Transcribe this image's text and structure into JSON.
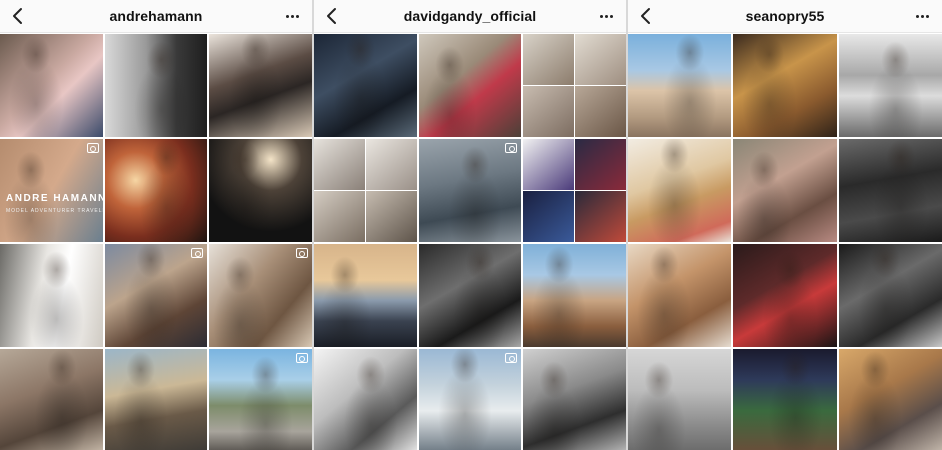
{
  "panels": [
    {
      "username": "andrehamann",
      "tiles": [
        {
          "desc": "man-in-pink-sweater-sofa",
          "video": false,
          "bg": "linear-gradient(135deg,#6b5a4e 0%,#c9a8a0 45%,#e8c6c4 60%,#3b4a6a 100%)"
        },
        {
          "desc": "man-profile-bw",
          "video": false,
          "bg": "linear-gradient(90deg,#d9d9d9 0%,#9a9a9a 40%,#3a3a3a 70%,#1e1e1e 100%)"
        },
        {
          "desc": "man-tattooed-breakfast",
          "video": false,
          "bg": "linear-gradient(160deg,#ebe4dc 0%,#5b4c44 40%,#2b2624 60%,#d9c9b6 100%)"
        },
        {
          "desc": "andre-hamann-banner",
          "video": true,
          "bg": "linear-gradient(120deg,#b58c6e 0%,#d4a98b 50%,#6a7f8f 100%)",
          "text": "ANDRE HAMANN",
          "sub": "MODEL ADVENTURER TRAVELER"
        },
        {
          "desc": "man-in-suit-spiral-light",
          "video": false,
          "bg": "radial-gradient(circle at 30% 40%,#f6d6a4 0%,#c0643a 30%,#7a2e1e 60%,#1d1410 100%)"
        },
        {
          "desc": "man-tuxedo-dark",
          "video": false,
          "bg": "radial-gradient(circle at 60% 20%,#f4e4c8 0%,#4d4238 30%,#121212 70%)"
        },
        {
          "desc": "man-white-shirt-window",
          "video": false,
          "bg": "linear-gradient(100deg,#6b6a66 0%,#e8e6e2 40%,#ffffff 60%,#cfcac2 100%)"
        },
        {
          "desc": "man-with-guitar",
          "video": true,
          "bg": "linear-gradient(150deg,#7c8aa0 0%,#bca48c 40%,#5e4536 70%,#2c2c34 100%)"
        },
        {
          "desc": "man-with-dog-closeup",
          "video": true,
          "bg": "linear-gradient(130deg,#e6e0d8 0%,#a88f78 40%,#6e5642 70%,#d8c8b4 100%)"
        },
        {
          "desc": "man-glasses-cat",
          "video": false,
          "bg": "linear-gradient(160deg,#b6a898 0%,#8c7666 40%,#54453a 70%,#c6b8a8 100%)"
        },
        {
          "desc": "man-cliff-coast",
          "video": false,
          "bg": "linear-gradient(170deg,#9bb6c8 0%,#cbb896 40%,#6a5a48 65%,#3d3a36 100%)"
        },
        {
          "desc": "mountain-road",
          "video": true,
          "bg": "linear-gradient(180deg,#7ab4e0 0%,#a9cfe8 30%,#7d8c6a 55%,#a8a49c 80%,#595550 100%)"
        }
      ]
    },
    {
      "username": "davidgandy_official",
      "tiles": [
        {
          "desc": "man-driving-car",
          "video": false,
          "bg": "linear-gradient(150deg,#1c2636 0%,#3e4e62 40%,#151b24 70%,#5a6a78 100%)"
        },
        {
          "desc": "dogs-on-sofa",
          "video": false,
          "bg": "linear-gradient(140deg,#cfc8bc 0%,#9a8a78 40%,#c03a4a 60%,#4b4038 100%)"
        },
        {
          "desc": "collage-relaxing",
          "video": false,
          "grid": "mini",
          "cells": [
            "linear-gradient(140deg,#d8d2c8,#8c7c6c)",
            "linear-gradient(140deg,#e2dcd2,#9e8e80)",
            "linear-gradient(140deg,#c8bcb0,#7c6c60)",
            "linear-gradient(140deg,#b8a898,#6a5646)"
          ]
        },
        {
          "desc": "collage-sleeping-dinner",
          "video": false,
          "grid": "mini",
          "cells": [
            "linear-gradient(140deg,#e6e2dc,#8a8078)",
            "linear-gradient(140deg,#eae6e0,#9a9088)",
            "linear-gradient(140deg,#d4ccc2,#7a6e62)",
            "linear-gradient(140deg,#c6bcb0,#5e544a)"
          ]
        },
        {
          "desc": "dog-in-puddle",
          "video": true,
          "bg": "linear-gradient(170deg,#9aa4ac 0%,#6c7882 40%,#3e4a54 70%,#8a949c 100%)"
        },
        {
          "desc": "sock-boxes-collage",
          "video": false,
          "grid": "mini",
          "cells": [
            "linear-gradient(140deg,#f2f2f2,#4a3a7a)",
            "linear-gradient(140deg,#2a2a44,#8a2a3a)",
            "linear-gradient(140deg,#1a2040,#3a5a9a)",
            "linear-gradient(140deg,#2a2a3a,#c04a3a)"
          ]
        },
        {
          "desc": "classic-car-sunset",
          "video": false,
          "bg": "linear-gradient(180deg,#d7b48a 0%,#e8c89a 35%,#8a9aac 55%,#3a4250 75%,#1a1e26 100%)"
        },
        {
          "desc": "man-tuxedo-event",
          "video": false,
          "bg": "linear-gradient(150deg,#2a2a2a 0%,#6e6e6e 40%,#1a1a1a 70%,#a8a8a8 100%)"
        },
        {
          "desc": "man-with-jaguar-desert",
          "video": false,
          "bg": "linear-gradient(180deg,#7fb0d8 0%,#a8c8e4 30%,#c8a482 55%,#8a5e3e 80%,#4a3a2e 100%)"
        },
        {
          "desc": "dog-sketch",
          "video": false,
          "bg": "linear-gradient(140deg,#f4f4f4 0%,#bdbdbd 40%,#5a5a5a 70%,#e6e6e6 100%)"
        },
        {
          "desc": "man-with-white-suv",
          "video": true,
          "bg": "linear-gradient(180deg,#9ab8d4 0%,#c4d2dc 35%,#e8ecee 60%,#6e7a84 100%)"
        },
        {
          "desc": "man-in-coat-dog-bw",
          "video": false,
          "bg": "linear-gradient(160deg,#d0d0d0 0%,#8a8a8a 40%,#2e2e2e 70%,#b8b8b8 100%)"
        }
      ]
    },
    {
      "username": "seanopry55",
      "tiles": [
        {
          "desc": "dog-on-beach",
          "video": false,
          "bg": "linear-gradient(180deg,#7ab0dc 0%,#a8c8e4 35%,#dcc4a8 55%,#b49c82 80%,#8a7460 100%)"
        },
        {
          "desc": "man-with-golden-dog",
          "video": false,
          "bg": "linear-gradient(150deg,#3a2a1e 0%,#c8944a 40%,#8a5a2e 70%,#2e2218 100%)"
        },
        {
          "desc": "oculus-hall-bw",
          "video": false,
          "bg": "linear-gradient(180deg,#e8e8e8 0%,#a8a8a8 40%,#dcdcdc 60%,#6a6a6a 100%)"
        },
        {
          "desc": "golden-dog-indoors",
          "video": false,
          "bg": "linear-gradient(160deg,#f2ece2 0%,#e0c8a2 40%,#c89a62 60%,#d06a5a 85%,#e8e2d8 100%)"
        },
        {
          "desc": "man-lying-shirt",
          "video": false,
          "bg": "linear-gradient(150deg,#8a8676 0%,#c2a090 40%,#6a4e42 70%,#b88a82 100%)"
        },
        {
          "desc": "skyscraper-bw",
          "video": false,
          "bg": "linear-gradient(170deg,#6a6a6a 0%,#2a2a2a 40%,#4a4a4a 70%,#1a1a1a 100%)"
        },
        {
          "desc": "man-sleeping-pillow",
          "video": false,
          "bg": "linear-gradient(150deg,#e8d8c4 0%,#c4946a 40%,#8a5e3e 70%,#e6dcd0 100%)"
        },
        {
          "desc": "man-sunglasses-red",
          "video": false,
          "bg": "linear-gradient(150deg,#2a1a1a 0%,#5e2a2a 40%,#c83a3a 60%,#1a1414 100%)"
        },
        {
          "desc": "man-piano-bw",
          "video": false,
          "bg": "linear-gradient(150deg,#1a1a1a 0%,#6a6a6a 40%,#2a2a2a 70%,#c8c8c8 100%)"
        },
        {
          "desc": "tower-in-fog-bw",
          "video": false,
          "bg": "linear-gradient(180deg,#d6d6d6 0%,#bcbcbc 40%,#8a8a8a 75%,#6a6a6a 100%)"
        },
        {
          "desc": "stadium-night",
          "video": false,
          "bg": "linear-gradient(180deg,#1a1a2e 0%,#2e3a5a 30%,#3a6a3e 60%,#6a4e3a 100%)"
        },
        {
          "desc": "man-with-dog-selfie",
          "video": false,
          "bg": "linear-gradient(150deg,#d8a86a 0%,#a8784a 40%,#5a4e4a 70%,#c4b8ac 100%)"
        }
      ]
    }
  ]
}
